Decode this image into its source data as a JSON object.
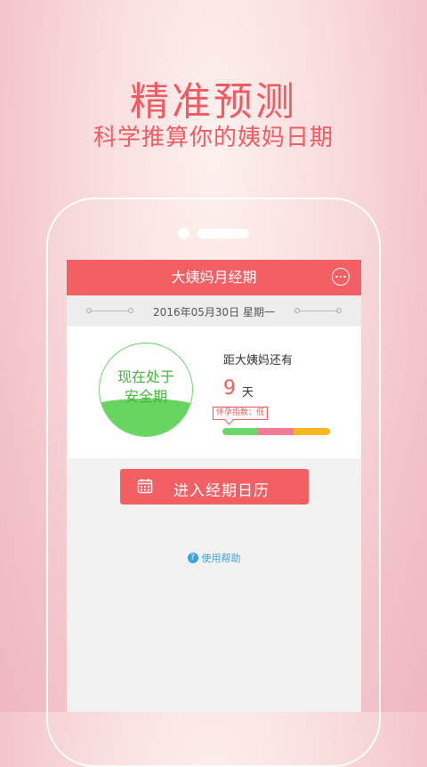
{
  "promo": {
    "headline": "精准预测",
    "subline": "科学推算你的姨妈日期"
  },
  "app": {
    "title": "大姨妈月经期",
    "date": "2016年05月30日 星期一",
    "status_line1": "现在处于",
    "status_line2": "安全期",
    "countdown_label": "距大姨妈还有",
    "countdown_days": "9",
    "countdown_unit": "天",
    "pregnancy_index": "怀孕指数：低",
    "enter_button": "进入经期日历",
    "help_link": "使用帮助"
  },
  "index_bar": [
    {
      "color": "#6cd666",
      "fraction": 0.33
    },
    {
      "color": "#f07c96",
      "fraction": 0.33
    },
    {
      "color": "#f5b51f",
      "fraction": 0.34
    }
  ],
  "colors": {
    "accent": "#f35f62",
    "safe_green": "#66d45f",
    "help_blue": "#3aa3e3"
  },
  "icons": [
    "more-icon",
    "calendar-icon",
    "help-icon"
  ]
}
